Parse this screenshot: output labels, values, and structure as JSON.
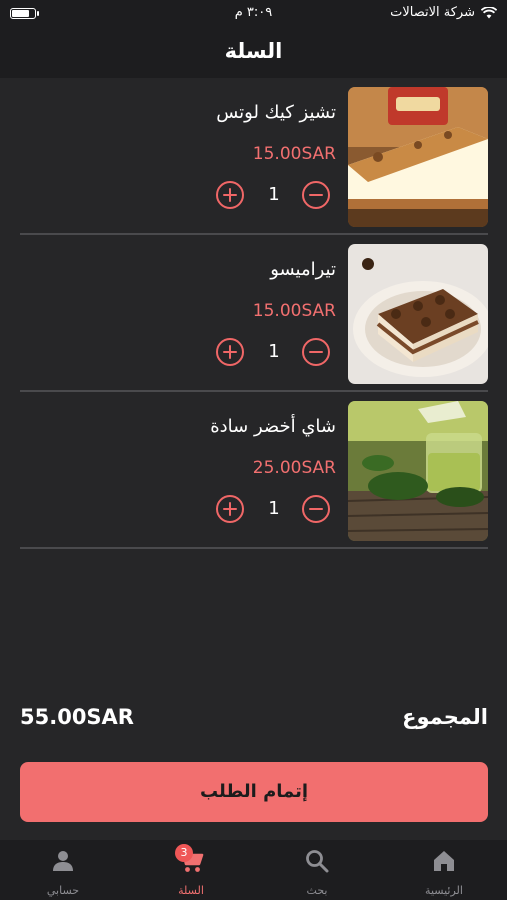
{
  "status_bar": {
    "carrier": "شركة الاتصالات",
    "time": "٣:٠٩ م",
    "battery_level": 0.85
  },
  "header": {
    "title": "السلة"
  },
  "cart": {
    "items": [
      {
        "name": "تشيز كيك لوتس",
        "price": "15.00SAR",
        "quantity": "1"
      },
      {
        "name": "تيراميسو",
        "price": "15.00SAR",
        "quantity": "1"
      },
      {
        "name": "شاي أخضر سادة",
        "price": "25.00SAR",
        "quantity": "1"
      }
    ]
  },
  "summary": {
    "total_label": "المجموع",
    "total_value": "55.00SAR"
  },
  "checkout": {
    "label": "إتمام الطلب"
  },
  "tabbar": {
    "tabs": [
      {
        "label": "الرئيسية",
        "icon": "home-icon"
      },
      {
        "label": "بحث",
        "icon": "search-icon"
      },
      {
        "label": "السلة",
        "icon": "cart-icon",
        "badge": "3"
      },
      {
        "label": "حسابي",
        "icon": "person-icon"
      }
    ],
    "active_tab": "السلة"
  },
  "colors": {
    "accent": "#f26f6f",
    "background": "#262628",
    "bar_background": "#1d1d1f",
    "inactive_tab": "#8e8e93"
  }
}
